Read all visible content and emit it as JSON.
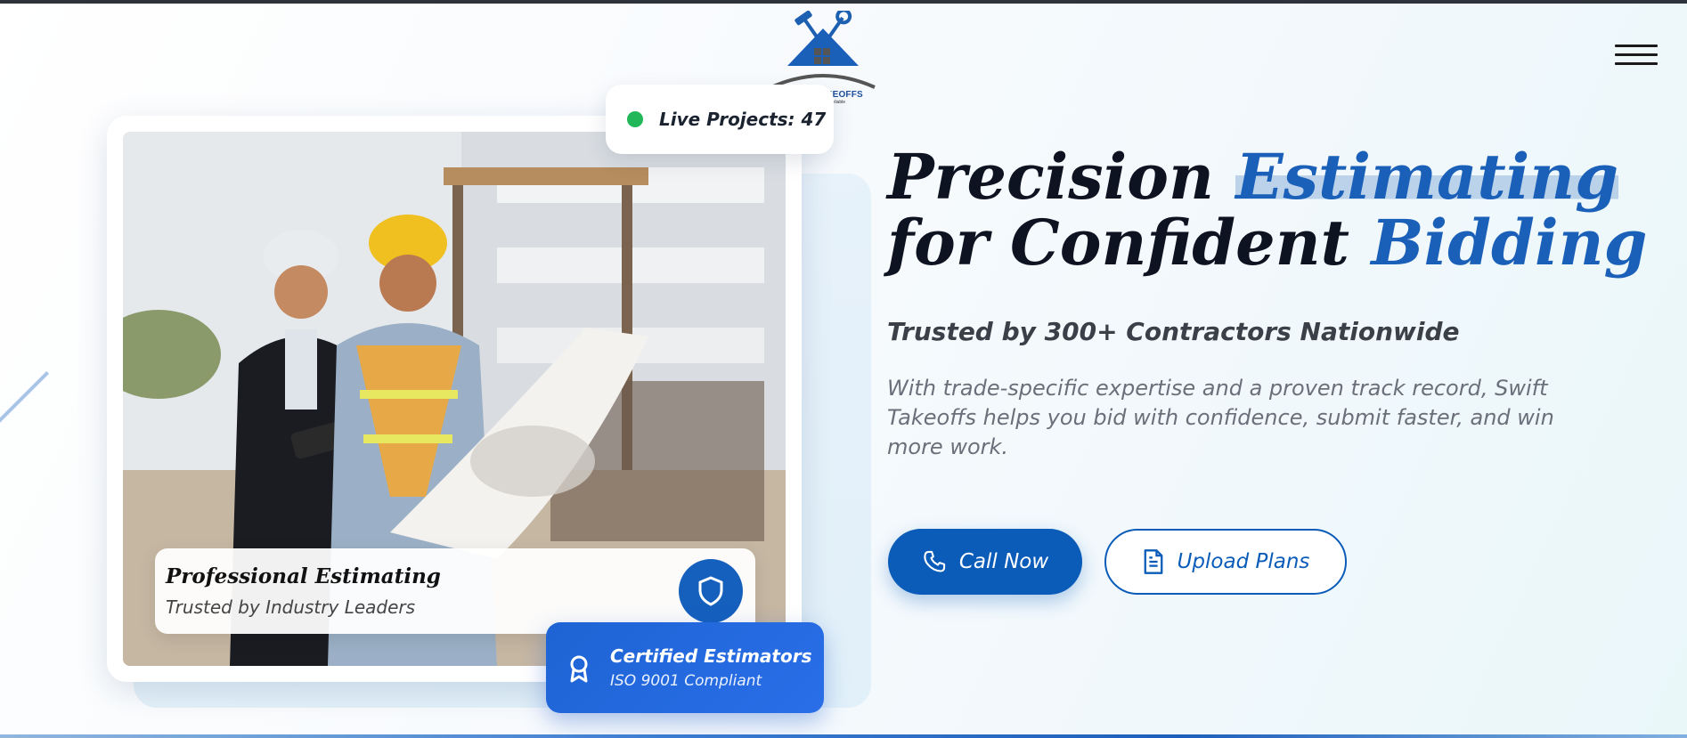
{
  "brand": {
    "name": "SWIFT TAKEOFFS",
    "tagline": "Fast Accurate Reliable",
    "accent_color": "#1a5fb8"
  },
  "header": {
    "menu_icon": "hamburger-menu-icon"
  },
  "live_badge": {
    "text": "Live Projects: 47",
    "status_color": "#22b85a"
  },
  "image_card": {
    "photo_alt": "Two construction professionals in hard hats reviewing blueprints on site",
    "caption_title": "Professional Estimating",
    "caption_subtitle": "Trusted by Industry Leaders",
    "caption_icon": "shield-icon"
  },
  "cert_badge": {
    "title": "Certified Estimators",
    "subtitle": "ISO 9001 Compliant",
    "icon": "award-ribbon-icon"
  },
  "hero": {
    "headline_word1": "Precision",
    "headline_word2": "Estimating",
    "headline_word3": "for Confident",
    "headline_word4": "Bidding",
    "subheading": "Trusted by 300+ Contractors Nationwide",
    "description": "With trade-specific expertise and a proven track record, Swift Takeoffs helps you bid with confidence, submit faster, and win more work."
  },
  "actions": {
    "call_label": "Call Now",
    "call_icon": "phone-icon",
    "upload_label": "Upload Plans",
    "upload_icon": "document-icon"
  }
}
